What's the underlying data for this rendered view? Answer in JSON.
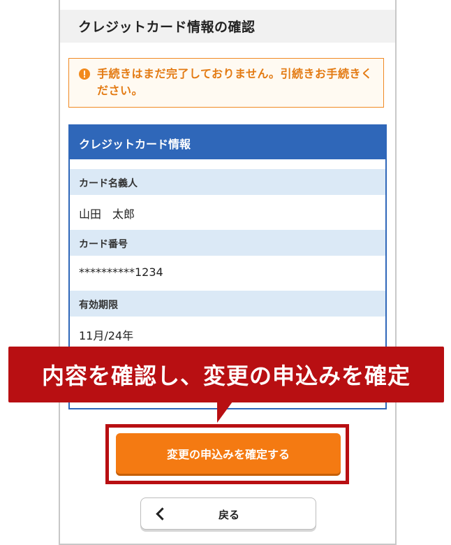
{
  "page": {
    "title": "クレジットカード情報の確認"
  },
  "notice": {
    "message": "手続きはまだ完了しておりません。引続きお手続きください。",
    "icon": "exclamation-icon",
    "color": "#f08a24"
  },
  "card_info": {
    "header": "クレジットカード情報",
    "fields": [
      {
        "label": "カード名義人",
        "value": "山田　太郎"
      },
      {
        "label": "カード番号",
        "value": "**********1234"
      },
      {
        "label": "有効期限",
        "value": "11月/24年"
      }
    ]
  },
  "annotation": {
    "banner_text": "内容を確認し、変更の申込みを確定",
    "color": "#b80f12"
  },
  "actions": {
    "confirm_label": "変更の申込みを確定する",
    "confirm_color": "#f47a12",
    "back_label": "戻る",
    "back_icon": "chevron-left-icon"
  },
  "colors": {
    "card_header": "#2f67b9",
    "field_label_bg": "#dbe9f6"
  }
}
